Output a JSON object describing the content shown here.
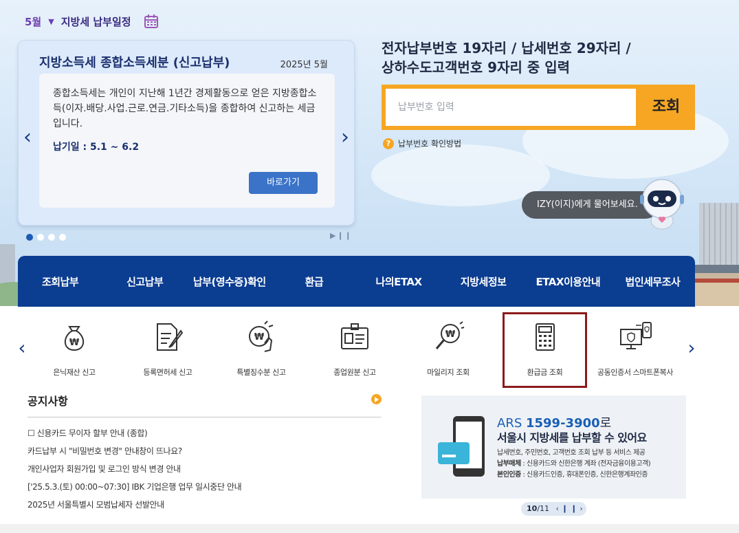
{
  "schedule": {
    "month": "5월",
    "label": "지방세 납부일정"
  },
  "slide": {
    "title": "지방소득세 종합소득세분 (신고납부)",
    "date": "2025년 5월",
    "description": "종합소득세는 개인이 지난해 1년간 경제활동으로 얻은 지방종합소득(이자.배당.사업.근로.연금.기타소득)을 종합하여 신고하는 세금입니다.",
    "due": "납기일 : 5.1 ~ 6.2",
    "button": "바로가기",
    "page_count": 4,
    "active_index": 0
  },
  "search": {
    "heading_line1": "전자납부번호 19자리 / 납세번호 29자리 /",
    "heading_line2": "상하수도고객번호 9자리 중 입력",
    "placeholder": "납부번호 입력",
    "button": "조회",
    "help": "납부번호 확인방법"
  },
  "izy": {
    "bubble": "IZY(이지)에게 물어보세요."
  },
  "nav": [
    "조회납부",
    "신고납부",
    "납부(영수증)확인",
    "환급",
    "나의ETAX",
    "지방세정보",
    "ETAX이용안내",
    "법인세무조사"
  ],
  "services": [
    {
      "label": "은닉재산 신고",
      "icon": "money-bag-icon"
    },
    {
      "label": "등록면허세 신고",
      "icon": "document-pen-icon"
    },
    {
      "label": "특별징수분 신고",
      "icon": "coin-hand-icon"
    },
    {
      "label": "종업원분 신고",
      "icon": "id-card-icon"
    },
    {
      "label": "마일리지 조회",
      "icon": "magnifier-coin-icon"
    },
    {
      "label": "환급금 조회",
      "icon": "calculator-icon",
      "selected": true
    },
    {
      "label": "공동인증서 스마트폰복사",
      "icon": "certificate-devices-icon"
    }
  ],
  "notice": {
    "heading": "공지사항",
    "items": [
      "☐ 신용카드 무이자 할부 안내 (종합)",
      "카드납부 시 \"비밀번호 변경\" 안내창이 뜨나요?",
      "개인사업자 회원가입 및 로그인 방식 변경 안내",
      "['25.5.3.(토) 00:00~07:30] IBK 기업은행 업무 일시중단 안내",
      "2025년 서울특별시 모범납세자 선발안내"
    ]
  },
  "ars": {
    "prefix": "ARS",
    "number": "1599-3900",
    "suffix": "로",
    "line2": "서울시 지방세를 납부할 수 있어요",
    "detail1": "납세번호, 주민번호, 고객번호 조회 납부 등 서비스 제공",
    "detail2_label": "납부매체",
    "detail2": " : 신용카드와 신한은행 계좌 (전자금융이용고객)",
    "detail3_label": "본인인증",
    "detail3": " : 신용카드인증, 휴대폰인증, 신한은행계좌인증"
  },
  "banner_pager": {
    "current": "10",
    "total": "/11"
  },
  "colors": {
    "navy": "#0b3d91",
    "orange": "#f6a623",
    "selected_border": "#8b1a1a"
  }
}
